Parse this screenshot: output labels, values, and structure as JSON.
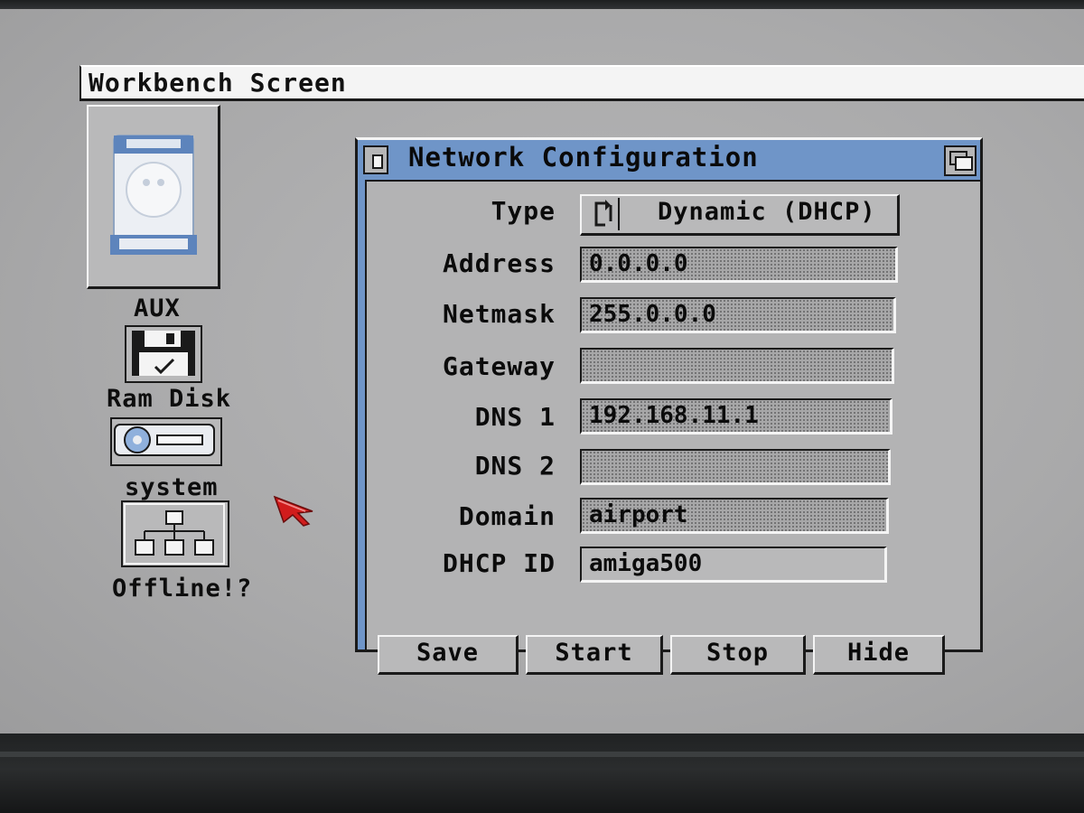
{
  "screen": {
    "title": "Workbench Screen"
  },
  "desktop_icons": [
    {
      "label": "AUX",
      "icon": "harddisk-icon"
    },
    {
      "label": "Ram Disk",
      "icon": "floppy-disk-icon"
    },
    {
      "label": "system",
      "icon": "drive-icon"
    },
    {
      "label": "Offline!?",
      "icon": "network-icon"
    }
  ],
  "window": {
    "title": "Network Configuration",
    "fields": {
      "type": {
        "label": "Type",
        "value": "Dynamic (DHCP)"
      },
      "address": {
        "label": "Address",
        "value": "0.0.0.0"
      },
      "netmask": {
        "label": "Netmask",
        "value": "255.0.0.0"
      },
      "gateway": {
        "label": "Gateway",
        "value": ""
      },
      "dns1": {
        "label": "DNS 1",
        "value": "192.168.11.1"
      },
      "dns2": {
        "label": "DNS 2",
        "value": ""
      },
      "domain": {
        "label": "Domain",
        "value": "airport"
      },
      "dhcp_id": {
        "label": "DHCP ID",
        "value": "amiga500"
      }
    },
    "buttons": {
      "save": "Save",
      "start": "Start",
      "stop": "Stop",
      "hide": "Hide"
    }
  },
  "colors": {
    "screen_bg": "#adadae",
    "window_title_bg": "#6f95c8",
    "pointer": "#d11c1c"
  }
}
